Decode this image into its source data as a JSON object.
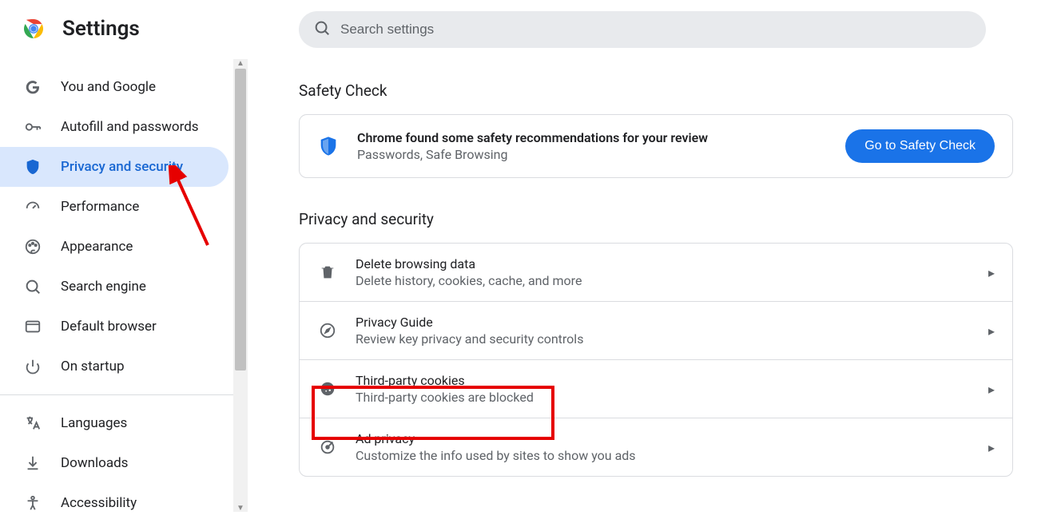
{
  "header": {
    "title": "Settings",
    "search_placeholder": "Search settings"
  },
  "sidebar": {
    "items": [
      {
        "label": "You and Google",
        "selected": false
      },
      {
        "label": "Autofill and passwords",
        "selected": false
      },
      {
        "label": "Privacy and security",
        "selected": true
      },
      {
        "label": "Performance",
        "selected": false
      },
      {
        "label": "Appearance",
        "selected": false
      },
      {
        "label": "Search engine",
        "selected": false
      },
      {
        "label": "Default browser",
        "selected": false
      },
      {
        "label": "On startup",
        "selected": false
      }
    ],
    "secondary": [
      {
        "label": "Languages"
      },
      {
        "label": "Downloads"
      },
      {
        "label": "Accessibility"
      }
    ]
  },
  "main": {
    "safety_section_title": "Safety Check",
    "safety_card": {
      "line1": "Chrome found some safety recommendations for your review",
      "line2": "Passwords, Safe Browsing",
      "button": "Go to Safety Check"
    },
    "privacy_section_title": "Privacy and security",
    "rows": [
      {
        "title": "Delete browsing data",
        "subtitle": "Delete history, cookies, cache, and more"
      },
      {
        "title": "Privacy Guide",
        "subtitle": "Review key privacy and security controls"
      },
      {
        "title": "Third-party cookies",
        "subtitle": "Third-party cookies are blocked"
      },
      {
        "title": "Ad privacy",
        "subtitle": "Customize the info used by sites to show you ads"
      }
    ]
  }
}
